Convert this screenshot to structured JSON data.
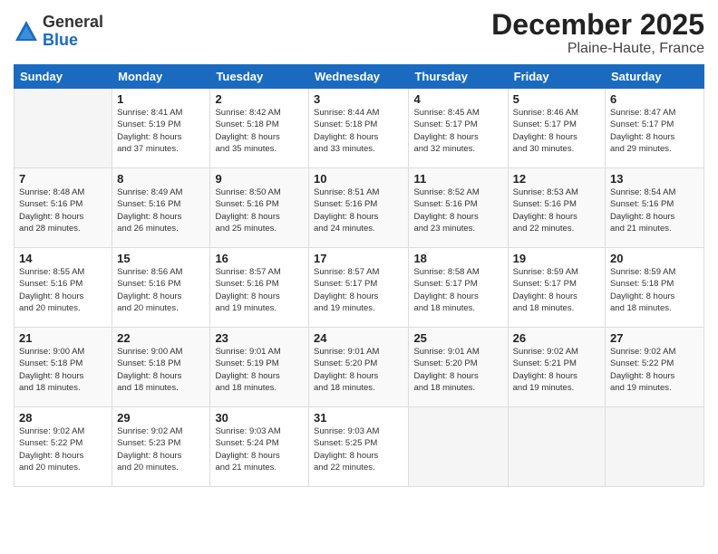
{
  "header": {
    "logo_general": "General",
    "logo_blue": "Blue",
    "month_title": "December 2025",
    "location": "Plaine-Haute, France"
  },
  "calendar": {
    "days_of_week": [
      "Sunday",
      "Monday",
      "Tuesday",
      "Wednesday",
      "Thursday",
      "Friday",
      "Saturday"
    ],
    "weeks": [
      [
        {
          "day": "",
          "info": ""
        },
        {
          "day": "1",
          "info": "Sunrise: 8:41 AM\nSunset: 5:19 PM\nDaylight: 8 hours\nand 37 minutes."
        },
        {
          "day": "2",
          "info": "Sunrise: 8:42 AM\nSunset: 5:18 PM\nDaylight: 8 hours\nand 35 minutes."
        },
        {
          "day": "3",
          "info": "Sunrise: 8:44 AM\nSunset: 5:18 PM\nDaylight: 8 hours\nand 33 minutes."
        },
        {
          "day": "4",
          "info": "Sunrise: 8:45 AM\nSunset: 5:17 PM\nDaylight: 8 hours\nand 32 minutes."
        },
        {
          "day": "5",
          "info": "Sunrise: 8:46 AM\nSunset: 5:17 PM\nDaylight: 8 hours\nand 30 minutes."
        },
        {
          "day": "6",
          "info": "Sunrise: 8:47 AM\nSunset: 5:17 PM\nDaylight: 8 hours\nand 29 minutes."
        }
      ],
      [
        {
          "day": "7",
          "info": "Sunrise: 8:48 AM\nSunset: 5:16 PM\nDaylight: 8 hours\nand 28 minutes."
        },
        {
          "day": "8",
          "info": "Sunrise: 8:49 AM\nSunset: 5:16 PM\nDaylight: 8 hours\nand 26 minutes."
        },
        {
          "day": "9",
          "info": "Sunrise: 8:50 AM\nSunset: 5:16 PM\nDaylight: 8 hours\nand 25 minutes."
        },
        {
          "day": "10",
          "info": "Sunrise: 8:51 AM\nSunset: 5:16 PM\nDaylight: 8 hours\nand 24 minutes."
        },
        {
          "day": "11",
          "info": "Sunrise: 8:52 AM\nSunset: 5:16 PM\nDaylight: 8 hours\nand 23 minutes."
        },
        {
          "day": "12",
          "info": "Sunrise: 8:53 AM\nSunset: 5:16 PM\nDaylight: 8 hours\nand 22 minutes."
        },
        {
          "day": "13",
          "info": "Sunrise: 8:54 AM\nSunset: 5:16 PM\nDaylight: 8 hours\nand 21 minutes."
        }
      ],
      [
        {
          "day": "14",
          "info": "Sunrise: 8:55 AM\nSunset: 5:16 PM\nDaylight: 8 hours\nand 20 minutes."
        },
        {
          "day": "15",
          "info": "Sunrise: 8:56 AM\nSunset: 5:16 PM\nDaylight: 8 hours\nand 20 minutes."
        },
        {
          "day": "16",
          "info": "Sunrise: 8:57 AM\nSunset: 5:16 PM\nDaylight: 8 hours\nand 19 minutes."
        },
        {
          "day": "17",
          "info": "Sunrise: 8:57 AM\nSunset: 5:17 PM\nDaylight: 8 hours\nand 19 minutes."
        },
        {
          "day": "18",
          "info": "Sunrise: 8:58 AM\nSunset: 5:17 PM\nDaylight: 8 hours\nand 18 minutes."
        },
        {
          "day": "19",
          "info": "Sunrise: 8:59 AM\nSunset: 5:17 PM\nDaylight: 8 hours\nand 18 minutes."
        },
        {
          "day": "20",
          "info": "Sunrise: 8:59 AM\nSunset: 5:18 PM\nDaylight: 8 hours\nand 18 minutes."
        }
      ],
      [
        {
          "day": "21",
          "info": "Sunrise: 9:00 AM\nSunset: 5:18 PM\nDaylight: 8 hours\nand 18 minutes."
        },
        {
          "day": "22",
          "info": "Sunrise: 9:00 AM\nSunset: 5:18 PM\nDaylight: 8 hours\nand 18 minutes."
        },
        {
          "day": "23",
          "info": "Sunrise: 9:01 AM\nSunset: 5:19 PM\nDaylight: 8 hours\nand 18 minutes."
        },
        {
          "day": "24",
          "info": "Sunrise: 9:01 AM\nSunset: 5:20 PM\nDaylight: 8 hours\nand 18 minutes."
        },
        {
          "day": "25",
          "info": "Sunrise: 9:01 AM\nSunset: 5:20 PM\nDaylight: 8 hours\nand 18 minutes."
        },
        {
          "day": "26",
          "info": "Sunrise: 9:02 AM\nSunset: 5:21 PM\nDaylight: 8 hours\nand 19 minutes."
        },
        {
          "day": "27",
          "info": "Sunrise: 9:02 AM\nSunset: 5:22 PM\nDaylight: 8 hours\nand 19 minutes."
        }
      ],
      [
        {
          "day": "28",
          "info": "Sunrise: 9:02 AM\nSunset: 5:22 PM\nDaylight: 8 hours\nand 20 minutes."
        },
        {
          "day": "29",
          "info": "Sunrise: 9:02 AM\nSunset: 5:23 PM\nDaylight: 8 hours\nand 20 minutes."
        },
        {
          "day": "30",
          "info": "Sunrise: 9:03 AM\nSunset: 5:24 PM\nDaylight: 8 hours\nand 21 minutes."
        },
        {
          "day": "31",
          "info": "Sunrise: 9:03 AM\nSunset: 5:25 PM\nDaylight: 8 hours\nand 22 minutes."
        },
        {
          "day": "",
          "info": ""
        },
        {
          "day": "",
          "info": ""
        },
        {
          "day": "",
          "info": ""
        }
      ]
    ]
  }
}
